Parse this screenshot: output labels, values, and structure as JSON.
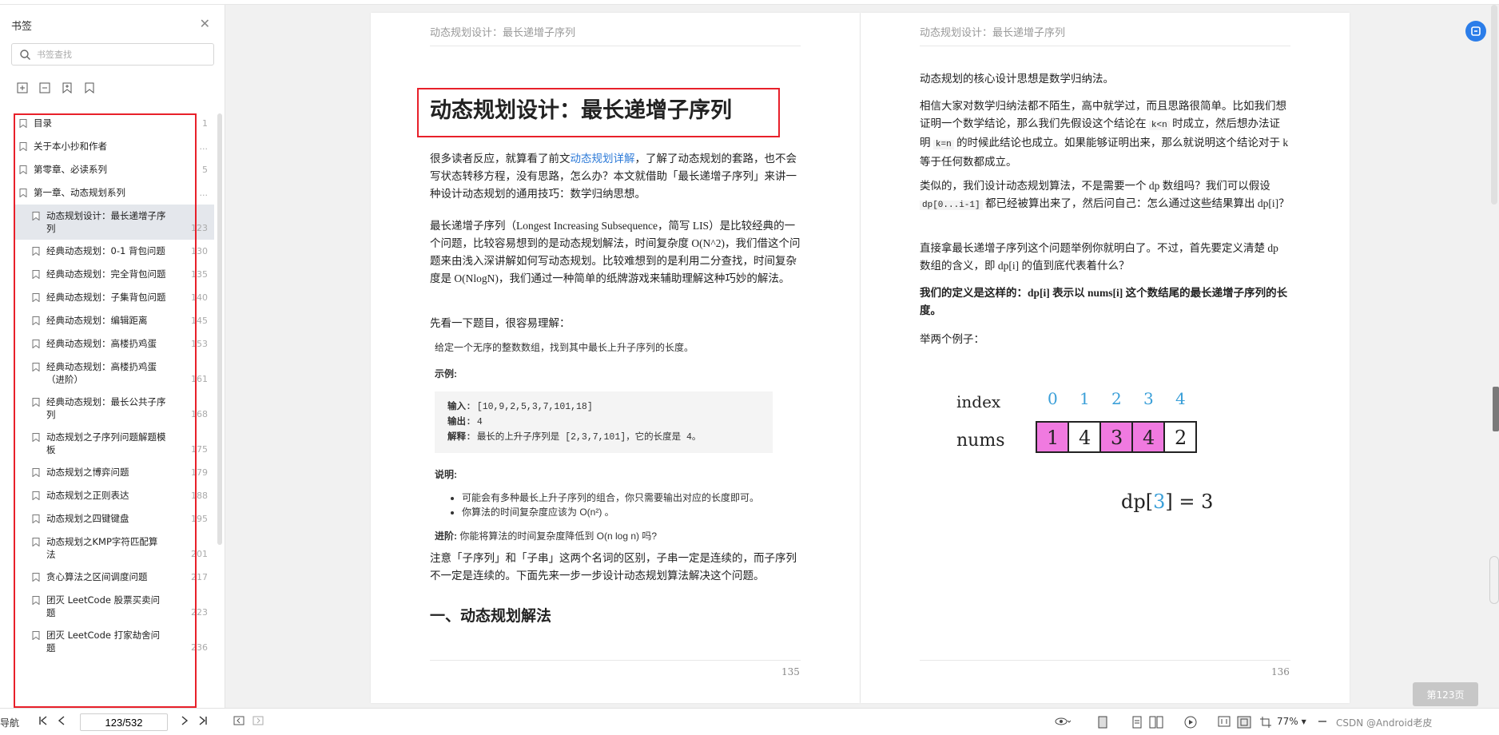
{
  "sidebar": {
    "title": "书签",
    "search_placeholder": "书签查找",
    "items": [
      {
        "label": "目录",
        "page": "1",
        "level": 1
      },
      {
        "label": "关于本小抄和作者",
        "page": "...",
        "level": 1
      },
      {
        "label": "第零章、必读系列",
        "page": "5",
        "level": 1
      },
      {
        "label": "第一章、动态规划系列",
        "page": "...",
        "level": 1
      },
      {
        "label": "动态规划设计：最长递增子序列",
        "page": "123",
        "level": 2,
        "selected": true
      },
      {
        "label": "经典动态规划：0-1 背包问题",
        "page": "130",
        "level": 2
      },
      {
        "label": "经典动态规划：完全背包问题",
        "page": "135",
        "level": 2
      },
      {
        "label": "经典动态规划：子集背包问题",
        "page": "140",
        "level": 2
      },
      {
        "label": "经典动态规划：编辑距离",
        "page": "145",
        "level": 2
      },
      {
        "label": "经典动态规划：高楼扔鸡蛋",
        "page": "153",
        "level": 2
      },
      {
        "label": "经典动态规划：高楼扔鸡蛋（进阶）",
        "page": "161",
        "level": 2
      },
      {
        "label": "经典动态规划：最长公共子序列",
        "page": "168",
        "level": 2
      },
      {
        "label": "动态规划之子序列问题解题模板",
        "page": "175",
        "level": 2
      },
      {
        "label": "动态规划之博弈问题",
        "page": "179",
        "level": 2
      },
      {
        "label": "动态规划之正则表达",
        "page": "188",
        "level": 2
      },
      {
        "label": "动态规划之四键键盘",
        "page": "195",
        "level": 2
      },
      {
        "label": "动态规划之KMP字符匹配算法",
        "page": "201",
        "level": 2
      },
      {
        "label": "贪心算法之区间调度问题",
        "page": "217",
        "level": 2
      },
      {
        "label": "团灭 LeetCode 股票买卖问题",
        "page": "223",
        "level": 2
      },
      {
        "label": "团灭 LeetCode 打家劫舍问题",
        "page": "236",
        "level": 2
      }
    ]
  },
  "left_page": {
    "header": "动态规划设计：最长递增子序列",
    "title": "动态规划设计：最长递增子序列",
    "p1_a": "很多读者反应，就算看了前文",
    "p1_link": "动态规划详解",
    "p1_b": "，了解了动态规划的套路，也不会写状态转移方程，没有思路，怎么办？本文就借助「最长递增子序列」来讲一种设计动态规划的通用技巧：数学归纳思想。",
    "p2": "最长递增子序列（Longest Increasing Subsequence，简写 LIS）是比较经典的一个问题，比较容易想到的是动态规划解法，时间复杂度 O(N^2)，我们借这个问题来由浅入深讲解如何写动态规划。比较难想到的是利用二分查找，时间复杂度是 O(NlogN)，我们通过一种简单的纸牌游戏来辅助理解这种巧妙的解法。",
    "p3": "先看一下题目，很容易理解：",
    "problem": "给定一个无序的整数数组，找到其中最长上升子序列的长度。",
    "example_label": "示例:",
    "ex_in_label": "输入:",
    "ex_in": "[10,9,2,5,3,7,101,18]",
    "ex_out_label": "输出:",
    "ex_out": "4",
    "ex_exp_label": "解释:",
    "ex_exp": "最长的上升子序列是 [2,3,7,101]，它的长度是 4。",
    "note_label": "说明:",
    "note1": "可能会有多种最长上升子序列的组合，你只需要输出对应的长度即可。",
    "note2": "你算法的时间复杂度应该为 O(n²) 。",
    "adv_label": "进阶:",
    "adv": "你能将算法的时间复杂度降低到 O(n log n) 吗?",
    "p4": "注意「子序列」和「子串」这两个名词的区别，子串一定是连续的，而子序列不一定是连续的。下面先来一步一步设计动态规划算法解决这个问题。",
    "h2": "一、动态规划解法",
    "page_number": "135"
  },
  "right_page": {
    "header": "动态规划设计：最长递增子序列",
    "p1": "动态规划的核心设计思想是数学归纳法。",
    "p2_a": "相信大家对数学归纳法都不陌生，高中就学过，而且思路很简单。比如我们想证明一个数学结论，那么我们先假设这个结论在",
    "p2_c1": "k<n",
    "p2_b": "时成立，然后想办法证明",
    "p2_c2": "k=n",
    "p2_c": "的时候此结论也成立。如果能够证明出来，那么就说明这个结论对于 k 等于任何数都成立。",
    "p3_a": "类似的，我们设计动态规划算法，不是需要一个 dp 数组吗？我们可以假设",
    "p3_code": "dp[0...i-1]",
    "p3_b": "都已经被算出来了，然后问自己：怎么通过这些结果算出 dp[i]？",
    "p4": "直接拿最长递增子序列这个问题举例你就明白了。不过，首先要定义清楚 dp 数组的含义，即 dp[i] 的值到底代表着什么？",
    "p5": "我们的定义是这样的：dp[i] 表示以 nums[i] 这个数结尾的最长递增子序列的长度。",
    "p6": "举两个例子：",
    "figure": {
      "index_label": "index",
      "nums_label": "nums",
      "indices": [
        "0",
        "1",
        "2",
        "3",
        "4"
      ],
      "nums": [
        "1",
        "4",
        "3",
        "4",
        "2"
      ],
      "highlight": [
        true,
        false,
        true,
        true,
        false
      ],
      "formula_a": "dp[",
      "formula_b": "3",
      "formula_c": "] = 3",
      "highlight_color": "#f07ae0",
      "index_color": "#3a9fd8"
    },
    "page_number": "136"
  },
  "bottombar": {
    "left_label": "导航",
    "page_value": "123/532",
    "zoom": "77%",
    "goto_page": "第123页",
    "watermark": "CSDN @Android老皮"
  },
  "colors": {
    "accent": "#2b7de9",
    "highlight_box": "#e8202a"
  }
}
